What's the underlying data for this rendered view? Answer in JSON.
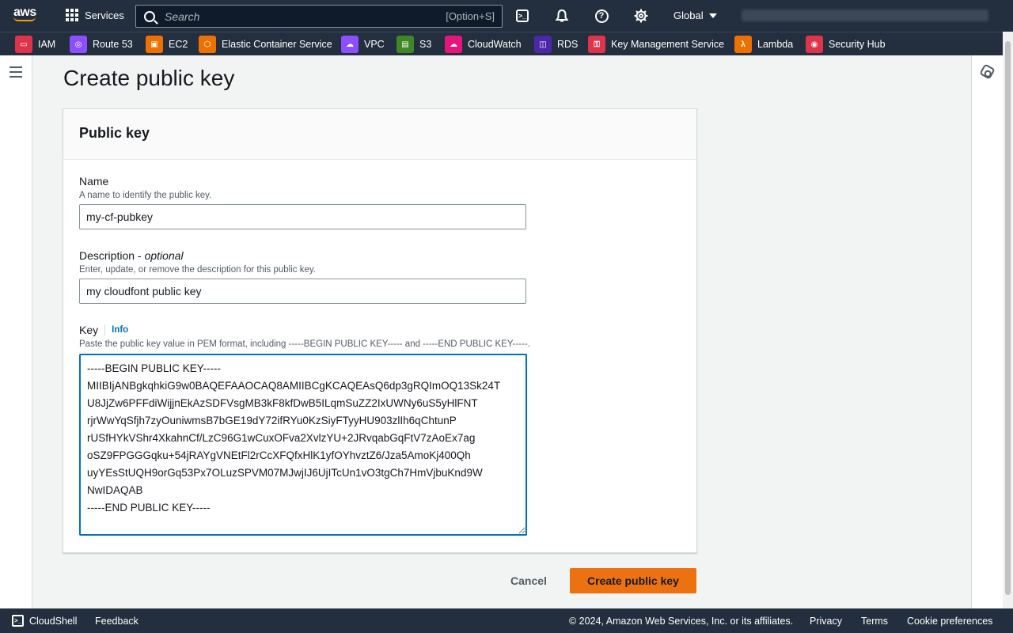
{
  "topnav": {
    "logo_text": "aws",
    "services_label": "Services",
    "search_placeholder": "Search",
    "search_shortcut": "[Option+S]",
    "region_label": "Global"
  },
  "favorites": [
    {
      "label": "IAM",
      "icon": "iam-icon",
      "color": "#dd344c"
    },
    {
      "label": "Route 53",
      "icon": "route53-icon",
      "color": "#8c4fff"
    },
    {
      "label": "EC2",
      "icon": "ec2-icon",
      "color": "#ed7100"
    },
    {
      "label": "Elastic Container Service",
      "icon": "ecs-icon",
      "color": "#ed7100"
    },
    {
      "label": "VPC",
      "icon": "vpc-icon",
      "color": "#8c4fff"
    },
    {
      "label": "S3",
      "icon": "s3-icon",
      "color": "#3f8624"
    },
    {
      "label": "CloudWatch",
      "icon": "cloudwatch-icon",
      "color": "#e7157b"
    },
    {
      "label": "RDS",
      "icon": "rds-icon",
      "color": "#4d27aa"
    },
    {
      "label": "Key Management Service",
      "icon": "kms-icon",
      "color": "#dd344c"
    },
    {
      "label": "Lambda",
      "icon": "lambda-icon",
      "color": "#ed7100"
    },
    {
      "label": "Security Hub",
      "icon": "security-hub-icon",
      "color": "#dd344c"
    }
  ],
  "page": {
    "title": "Create public key",
    "panel_title": "Public key"
  },
  "form": {
    "name": {
      "label": "Name",
      "description": "A name to identify the public key.",
      "value": "my-cf-pubkey"
    },
    "description": {
      "label": "Description -",
      "optional": "optional",
      "description": "Enter, update, or remove the description for this public key.",
      "value": "my cloudfont public key"
    },
    "key": {
      "label": "Key",
      "info": "Info",
      "description": "Paste the public key value in PEM format, including -----BEGIN PUBLIC KEY----- and -----END PUBLIC KEY-----.",
      "value": "-----BEGIN PUBLIC KEY-----\nMIIBIjANBgkqhkiG9w0BAQEFAAOCAQ8AMIIBCgKCAQEAsQ6dp3gRQImOQ13Sk24T\nU8JjZw6PFFdiWijjnEkAzSDFVsgMB3kF8kfDwB5ILqmSuZZ2IxUWNy6uS5yHlFNT\nrjrWwYqSfjh7zyOuniwmsB7bGE19dY72ifRYu0KzSiyFTyyHU903zlIh6qChtunP\nrUSfHYkVShr4XkahnCf/LzC96G1wCuxOFva2XvlzYU+2JRvqabGqFtV7zAoEx7ag\noSZ9FPGGGqku+54jRAYgVNEtFl2rCcXFQfxHlK1yfOYhvztZ6/Jza5AmoKj400Qh\nuyYEsStUQH9orGq53Px7OLuzSPVM07MJwjIJ6UjITcUn1vO3tgCh7HmVjbuKnd9W\nNwIDAQAB\n-----END PUBLIC KEY-----"
    }
  },
  "actions": {
    "cancel": "Cancel",
    "create": "Create public key"
  },
  "footer": {
    "cloudshell": "CloudShell",
    "feedback": "Feedback",
    "copyright": "© 2024, Amazon Web Services, Inc. or its affiliates.",
    "privacy": "Privacy",
    "terms": "Terms",
    "cookie": "Cookie preferences"
  },
  "colors": {
    "nav_bg": "#232f3e",
    "primary_button": "#ec7211",
    "link": "#0073bb"
  }
}
